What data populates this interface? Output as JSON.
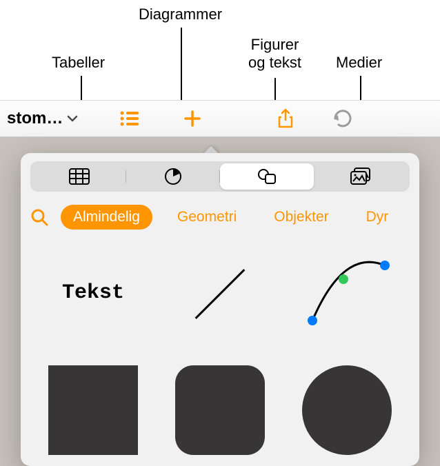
{
  "callouts": {
    "tables": "Tabeller",
    "charts": "Diagrammer",
    "shapes": "Figurer\nog tekst",
    "media": "Medier"
  },
  "toolbar": {
    "doc_title": "stom…"
  },
  "categories": {
    "basic": "Almindelig",
    "geometry": "Geometri",
    "objects": "Objekter",
    "animals": "Dyr"
  },
  "shapes": {
    "text_label": "Tekst"
  },
  "colors": {
    "accent": "#ff9500",
    "shape_dark": "#373536"
  }
}
